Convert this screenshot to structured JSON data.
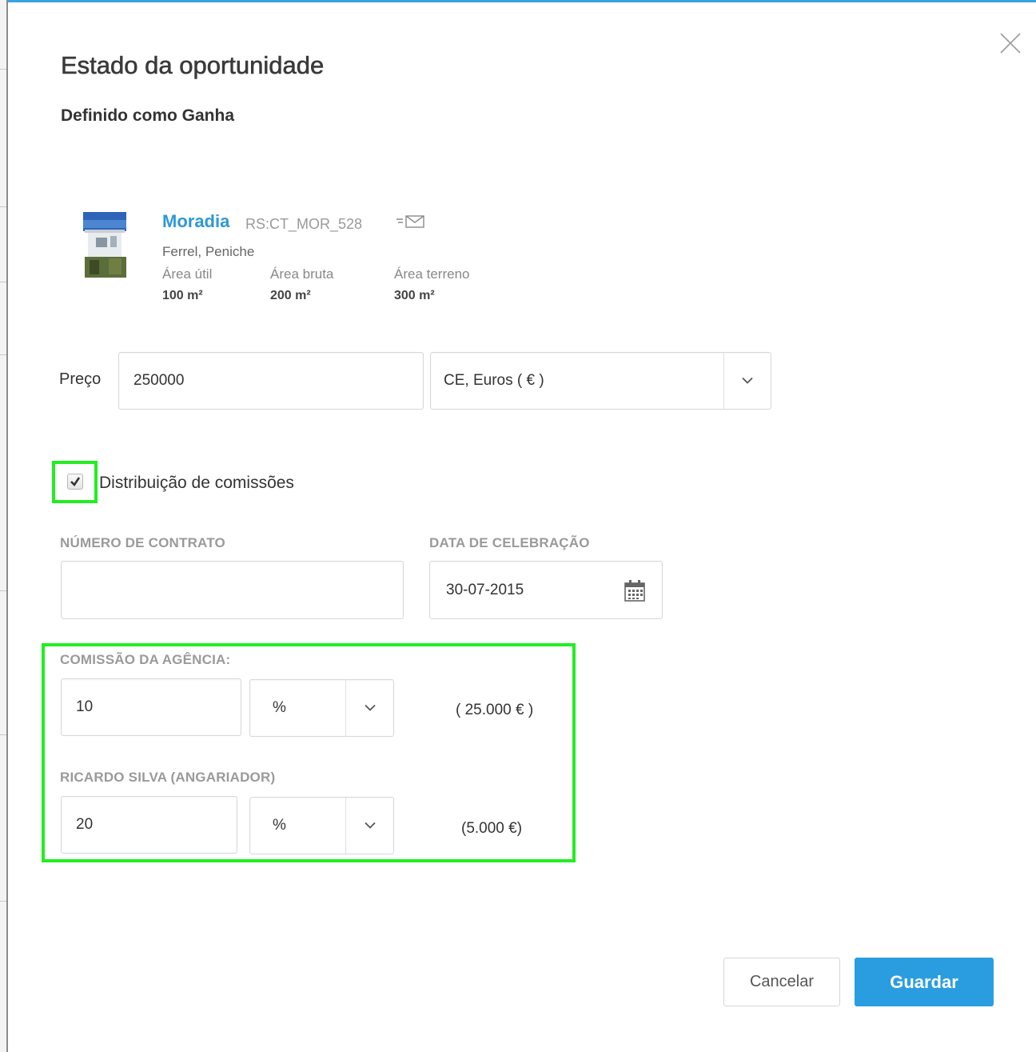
{
  "modal": {
    "title": "Estado da oportunidade",
    "subtitle": "Definido como Ganha"
  },
  "property": {
    "title": "Moradia",
    "reference": "RS:CT_MOR_528",
    "location": "Ferrel, Peniche",
    "stats": [
      {
        "label": "Área útil",
        "value": "100 m²"
      },
      {
        "label": "Área bruta",
        "value": "200 m²"
      },
      {
        "label": "Área terreno",
        "value": "300 m²"
      }
    ]
  },
  "price": {
    "label": "Preço",
    "value": "250000",
    "currency": "CE, Euros ( € )"
  },
  "commission": {
    "checkbox_label": "Distribuição de comissões",
    "checked": true,
    "contract_label": "NÚMERO DE CONTRATO",
    "contract_value": "",
    "date_label": "DATA DE CELEBRAÇÃO",
    "date_value": "30-07-2015",
    "agency": {
      "label": "COMISSÃO DA AGÊNCIA:",
      "value": "10",
      "unit": "%",
      "amount": "( 25.000  € )"
    },
    "agent": {
      "label": "RICARDO SILVA  (ANGARIADOR)",
      "value": "20",
      "unit": "%",
      "amount": "(5.000  €)"
    }
  },
  "buttons": {
    "cancel": "Cancelar",
    "save": "Guardar"
  },
  "colors": {
    "accent": "#2a9de0",
    "highlight": "#22ee22",
    "link": "#2f98d8"
  }
}
